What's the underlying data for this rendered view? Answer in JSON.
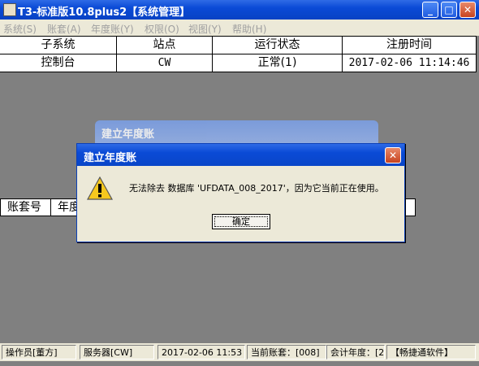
{
  "window": {
    "title": "T3-标准版10.8plus2【系统管理】",
    "minimize": "_",
    "maximize": "□",
    "close": "✕"
  },
  "menu": [
    "系统(S)",
    "账套(A)",
    "年度账(Y)",
    "权限(O)",
    "视图(Y)",
    "帮助(H)"
  ],
  "table": {
    "headers": [
      "子系统",
      "站点",
      "运行状态",
      "注册时间"
    ],
    "rows": [
      [
        "控制台",
        "CW",
        "正常(1)",
        "2017-02-06 11:14:46"
      ]
    ]
  },
  "background_dialog": {
    "title": "建立年度账"
  },
  "background_grid": {
    "headers": [
      "账套号",
      "年度"
    ]
  },
  "dialog": {
    "title": "建立年度账",
    "message": "无法除去 数据库 'UFDATA_008_2017'，因为它当前正在使用。",
    "ok": "确定",
    "icon": "warning-icon",
    "close": "✕"
  },
  "status": {
    "operator": "操作员[董方]",
    "server": "服务器[CW]",
    "datetime": "2017-02-06 11:53",
    "account": "当前账套：[008]",
    "fiscal_year": "会计年度：[2",
    "brand": "【畅捷通软件】"
  },
  "colors": {
    "title_blue": "#0a4ad6",
    "desktop_gray": "#808080",
    "face": "#ece9d8"
  }
}
